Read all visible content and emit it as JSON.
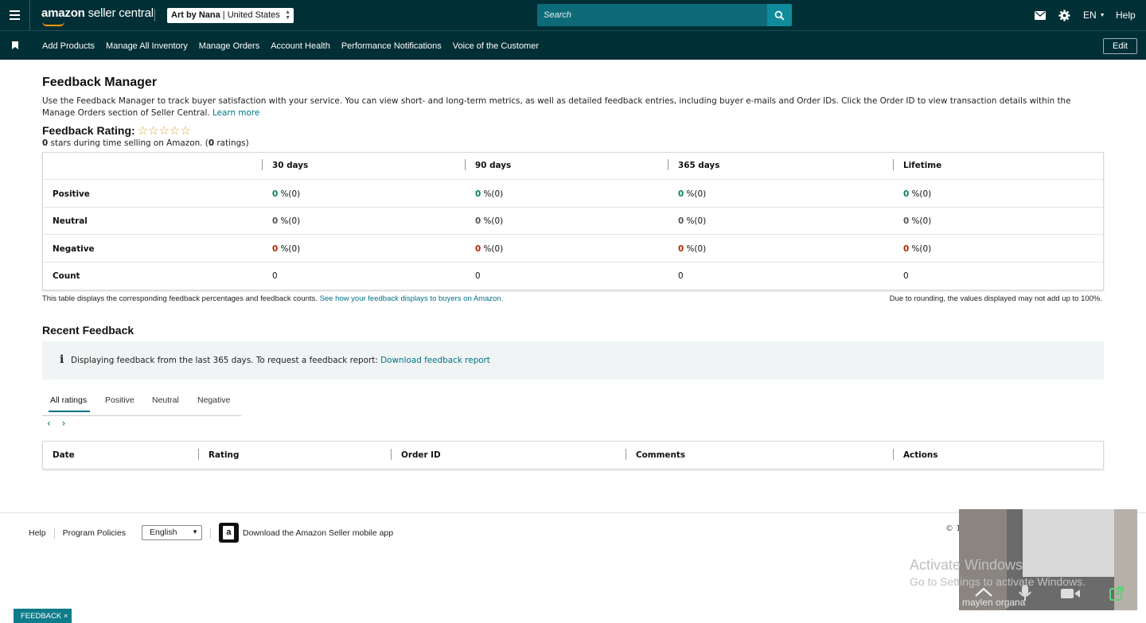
{
  "header": {
    "logo_bold": "amazon",
    "logo_rest": " seller central",
    "account_name": "Art by Nana",
    "account_sep": " | ",
    "account_market": "United States",
    "search_placeholder": "Search",
    "language": "EN",
    "help": "Help"
  },
  "nav": {
    "items": [
      "Add Products",
      "Manage All Inventory",
      "Manage Orders",
      "Account Health",
      "Performance Notifications",
      "Voice of the Customer"
    ],
    "edit": "Edit"
  },
  "page": {
    "title": "Feedback Manager",
    "intro": "Use the Feedback Manager to track buyer satisfaction with your service. You can view short- and long-term metrics, as well as detailed feedback entries, including buyer e-mails and Order IDs. Click the Order ID to view transaction details within the Manage Orders section of Seller Central.",
    "learn_more": "Learn more",
    "rating_label": "Feedback Rating:",
    "stars": "☆☆☆☆☆",
    "rating_stars": "0",
    "rating_text_1": " stars during time selling on Amazon. (",
    "rating_count": "0",
    "rating_text_2": " ratings)"
  },
  "metrics": {
    "columns": [
      "30 days",
      "90 days",
      "365 days",
      "Lifetime"
    ],
    "rows": [
      {
        "label": "Positive",
        "values": [
          "0",
          "0",
          "0",
          "0"
        ],
        "suffix": "%(0)"
      },
      {
        "label": "Neutral",
        "values": [
          "0",
          "0",
          "0",
          "0"
        ],
        "suffix": "%(0)"
      },
      {
        "label": "Negative",
        "values": [
          "0",
          "0",
          "0",
          "0"
        ],
        "suffix": "%(0)"
      },
      {
        "label": "Count",
        "values": [
          "0",
          "0",
          "0",
          "0"
        ],
        "suffix": ""
      }
    ],
    "note": "This table displays the corresponding feedback percentages and feedback counts.",
    "note_link": "See how your feedback displays to buyers on Amazon.",
    "rounding_note": "Due to rounding, the values displayed may not add up to 100%."
  },
  "recent": {
    "title": "Recent Feedback",
    "info_icon": "i",
    "info_text": "Displaying feedback from the last 365 days. To request a feedback report:",
    "info_link": "Download feedback report",
    "tabs": [
      "All ratings",
      "Positive",
      "Neutral",
      "Negative"
    ],
    "prev": "‹",
    "next": "›",
    "table_headers": [
      "Date",
      "Rating",
      "Order ID",
      "Comments",
      "Actions"
    ]
  },
  "footer": {
    "help": "Help",
    "policies": "Program Policies",
    "language": "English",
    "app_text": "Download the Amazon Seller mobile app",
    "copyright": "© 1"
  },
  "overlay": {
    "activate_title": "Activate Windows",
    "activate_sub": "Go to Settings to activate Windows.",
    "participant": "maylen organa",
    "feedback_tab": "FEEDBACK ×"
  },
  "colors": {
    "header_bg": "#002f36",
    "link": "#007185",
    "positive": "#067d62",
    "negative": "#b12704",
    "star": "#e3a33d"
  }
}
